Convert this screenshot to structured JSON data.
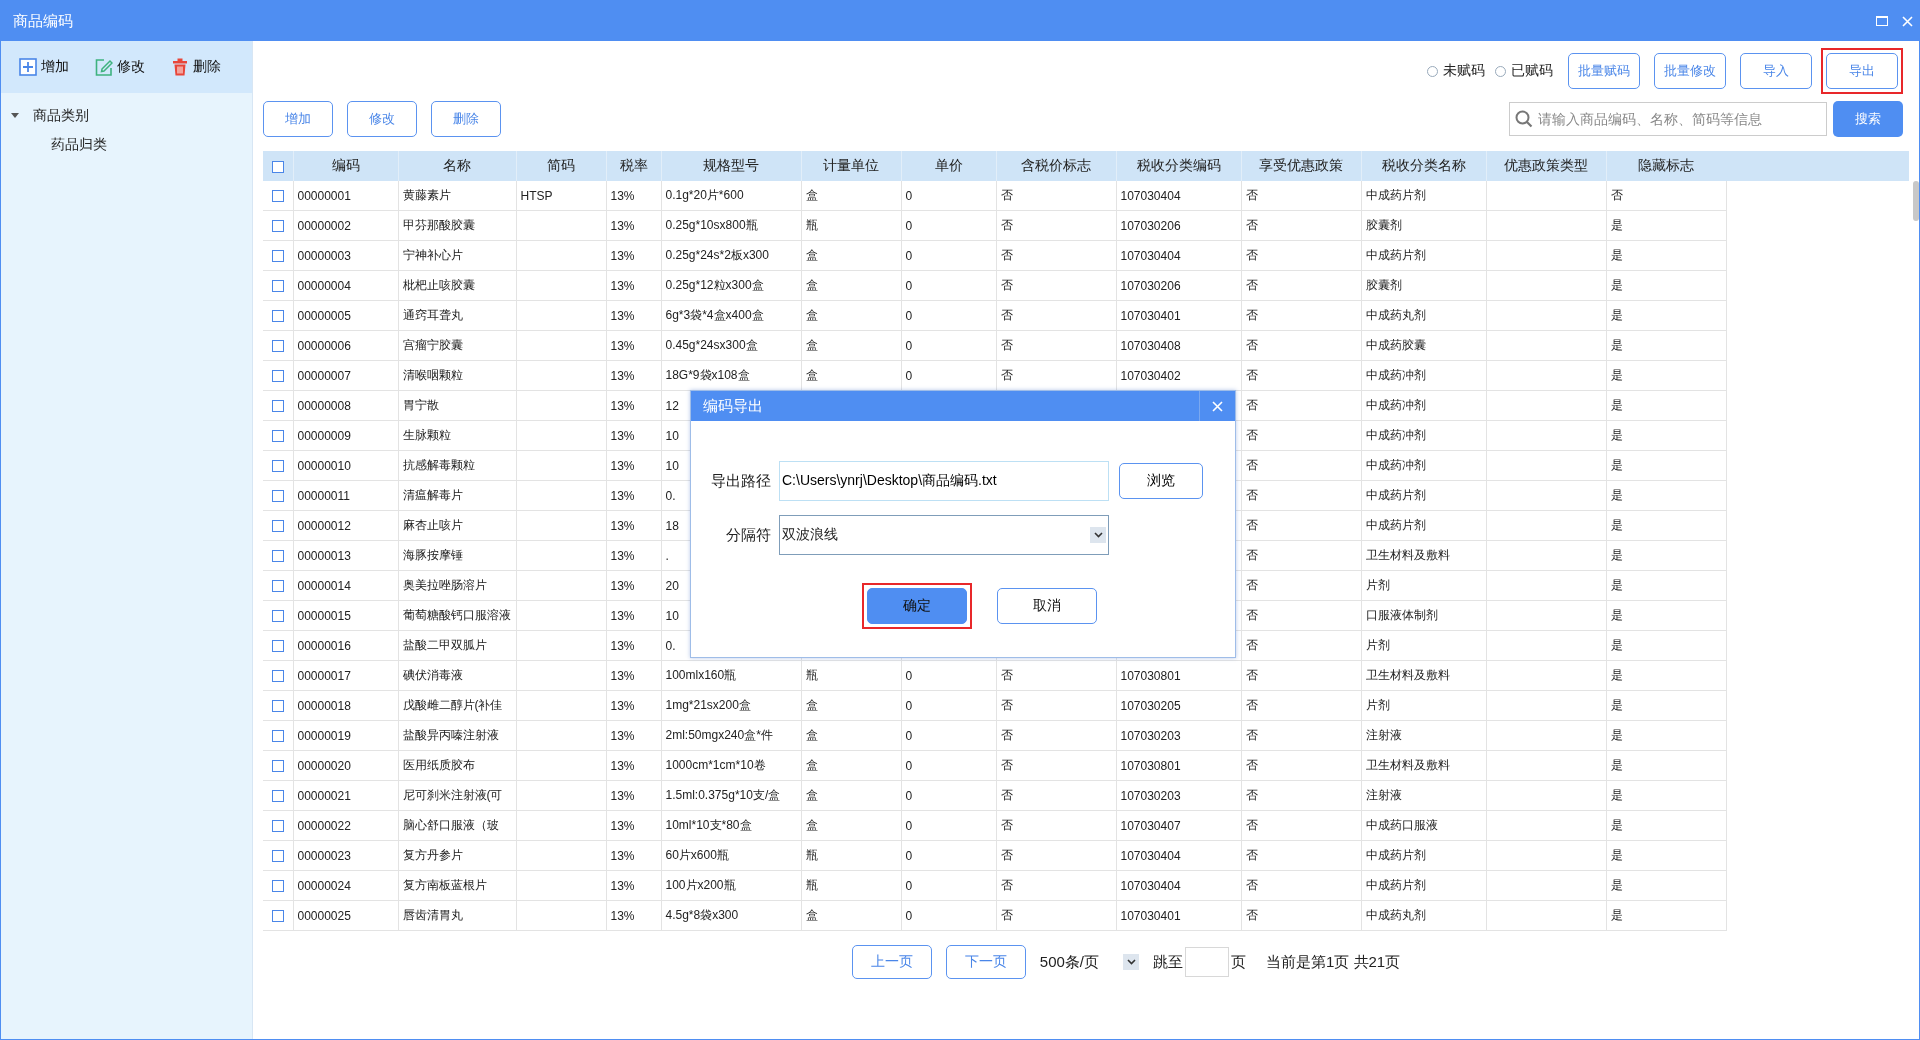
{
  "window": {
    "title": "商品编码"
  },
  "sidebar": {
    "toolbar": [
      {
        "kind": "add",
        "label": "增加"
      },
      {
        "kind": "edit",
        "label": "修改"
      },
      {
        "kind": "delete",
        "label": "删除"
      }
    ],
    "tree": [
      {
        "label": "商品类别",
        "expanded": true,
        "children": [
          {
            "label": "药品归类"
          }
        ]
      }
    ]
  },
  "filters": [
    {
      "label": "未赋码",
      "selected": false
    },
    {
      "label": "已赋码",
      "selected": false
    }
  ],
  "top_buttons": [
    {
      "label": "批量赋码",
      "highlighted": false
    },
    {
      "label": "批量修改",
      "highlighted": false
    },
    {
      "label": "导入",
      "highlighted": false
    },
    {
      "label": "导出",
      "highlighted": true
    }
  ],
  "row_buttons": [
    "增加",
    "修改",
    "删除"
  ],
  "search": {
    "placeholder": "请输入商品编码、名称、简码等信息",
    "button": "搜索"
  },
  "table": {
    "select_all": false,
    "columns": [
      "编码",
      "名称",
      "简码",
      "税率",
      "规格型号",
      "计量单位",
      "单价",
      "含税价标志",
      "税收分类编码",
      "享受优惠政策",
      "税收分类名称",
      "优惠政策类型",
      "隐藏标志"
    ],
    "rows": [
      {
        "checked": false,
        "cells": [
          "00000001",
          "黄藤素片",
          "HTSP",
          "13%",
          "0.1g*20片*600",
          "盒",
          "0",
          "否",
          "107030404",
          "否",
          "中成药片剂",
          null,
          "否"
        ]
      },
      {
        "checked": false,
        "cells": [
          "00000002",
          "甲芬那酸胶囊",
          null,
          "13%",
          "0.25g*10sx800瓶",
          "瓶",
          "0",
          "否",
          "107030206",
          "否",
          "胶囊剂",
          null,
          "是"
        ]
      },
      {
        "checked": false,
        "cells": [
          "00000003",
          "宁神补心片",
          null,
          "13%",
          "0.25g*24s*2板x300",
          "盒",
          "0",
          "否",
          "107030404",
          "否",
          "中成药片剂",
          null,
          "是"
        ]
      },
      {
        "checked": false,
        "cells": [
          "00000004",
          "枇杷止咳胶囊",
          null,
          "13%",
          "0.25g*12粒x300盒",
          "盒",
          "0",
          "否",
          "107030206",
          "否",
          "胶囊剂",
          null,
          "是"
        ]
      },
      {
        "checked": false,
        "cells": [
          "00000005",
          "通窍耳聋丸",
          null,
          "13%",
          "6g*3袋*4盒x400盒",
          "盒",
          "0",
          "否",
          "107030401",
          "否",
          "中成药丸剂",
          null,
          "是"
        ]
      },
      {
        "checked": false,
        "cells": [
          "00000006",
          "宫瘤宁胶囊",
          null,
          "13%",
          "0.45g*24sx300盒",
          "盒",
          "0",
          "否",
          "107030408",
          "否",
          "中成药胶囊",
          null,
          "是"
        ]
      },
      {
        "checked": false,
        "cells": [
          "00000007",
          "清喉咽颗粒",
          null,
          "13%",
          "18G*9袋x108盒",
          "盒",
          "0",
          "否",
          "107030402",
          "否",
          "中成药冲剂",
          null,
          "是"
        ]
      },
      {
        "checked": false,
        "cells": [
          "00000008",
          "胃宁散",
          null,
          "13%",
          "12",
          null,
          null,
          null,
          null,
          "否",
          "中成药冲剂",
          null,
          "是"
        ]
      },
      {
        "checked": false,
        "cells": [
          "00000009",
          "生脉颗粒",
          null,
          "13%",
          "10",
          null,
          null,
          null,
          null,
          "否",
          "中成药冲剂",
          null,
          "是"
        ]
      },
      {
        "checked": false,
        "cells": [
          "00000010",
          "抗感解毒颗粒",
          null,
          "13%",
          "10",
          null,
          null,
          null,
          null,
          "否",
          "中成药冲剂",
          null,
          "是"
        ]
      },
      {
        "checked": false,
        "cells": [
          "00000011",
          "清瘟解毒片",
          null,
          "13%",
          "0.",
          null,
          null,
          null,
          null,
          "否",
          "中成药片剂",
          null,
          "是"
        ]
      },
      {
        "checked": false,
        "cells": [
          "00000012",
          "麻杏止咳片",
          null,
          "13%",
          "18",
          null,
          null,
          null,
          null,
          "否",
          "中成药片剂",
          null,
          "是"
        ]
      },
      {
        "checked": false,
        "cells": [
          "00000013",
          "海豚按摩锤",
          null,
          "13%",
          ".",
          null,
          null,
          null,
          null,
          "否",
          "卫生材料及敷料",
          null,
          "是"
        ]
      },
      {
        "checked": false,
        "cells": [
          "00000014",
          "奥美拉唑肠溶片",
          null,
          "13%",
          "20",
          null,
          null,
          null,
          null,
          "否",
          "片剂",
          null,
          "是"
        ]
      },
      {
        "checked": false,
        "cells": [
          "00000015",
          "葡萄糖酸钙口服溶液",
          null,
          "13%",
          "10",
          null,
          null,
          null,
          null,
          "否",
          "口服液体制剂",
          null,
          "是"
        ]
      },
      {
        "checked": false,
        "cells": [
          "00000016",
          "盐酸二甲双胍片",
          null,
          "13%",
          "0.",
          null,
          null,
          null,
          null,
          "否",
          "片剂",
          null,
          "是"
        ]
      },
      {
        "checked": false,
        "cells": [
          "00000017",
          "碘伏消毒液",
          null,
          "13%",
          "100mlx160瓶",
          "瓶",
          "0",
          "否",
          "107030801",
          "否",
          "卫生材料及敷料",
          null,
          "是"
        ]
      },
      {
        "checked": false,
        "cells": [
          "00000018",
          "戊酸雌二醇片(补佳",
          null,
          "13%",
          "1mg*21sx200盒",
          "盒",
          "0",
          "否",
          "107030205",
          "否",
          "片剂",
          null,
          "是"
        ]
      },
      {
        "checked": false,
        "cells": [
          "00000019",
          "盐酸异丙嗪注射液",
          null,
          "13%",
          "2ml:50mgx240盒*件",
          "盒",
          "0",
          "否",
          "107030203",
          "否",
          "注射液",
          null,
          "是"
        ]
      },
      {
        "checked": false,
        "cells": [
          "00000020",
          "医用纸质胶布",
          null,
          "13%",
          "1000cm*1cm*10卷",
          "盒",
          "0",
          "否",
          "107030801",
          "否",
          "卫生材料及敷料",
          null,
          "是"
        ]
      },
      {
        "checked": false,
        "cells": [
          "00000021",
          "尼可刹米注射液(可",
          null,
          "13%",
          "1.5ml:0.375g*10支/盒",
          "盒",
          "0",
          "否",
          "107030203",
          "否",
          "注射液",
          null,
          "是"
        ]
      },
      {
        "checked": false,
        "cells": [
          "00000022",
          "脑心舒口服液（玻",
          null,
          "13%",
          "10ml*10支*80盒",
          "盒",
          "0",
          "否",
          "107030407",
          "否",
          "中成药口服液",
          null,
          "是"
        ]
      },
      {
        "checked": false,
        "cells": [
          "00000023",
          "复方丹参片",
          null,
          "13%",
          "60片x600瓶",
          "瓶",
          "0",
          "否",
          "107030404",
          "否",
          "中成药片剂",
          null,
          "是"
        ]
      },
      {
        "checked": false,
        "cells": [
          "00000024",
          "复方南板蓝根片",
          null,
          "13%",
          "100片x200瓶",
          "瓶",
          "0",
          "否",
          "107030404",
          "否",
          "中成药片剂",
          null,
          "是"
        ]
      },
      {
        "checked": false,
        "cells": [
          "00000025",
          "唇齿清胃丸",
          null,
          "13%",
          "4.5g*8袋x300",
          "盒",
          "0",
          "否",
          "107030401",
          "否",
          "中成药丸剂",
          null,
          "是"
        ]
      }
    ]
  },
  "pagination": {
    "prev": "上一页",
    "next": "下一页",
    "page_size": "500条/页",
    "jump_label": "跳至",
    "page_unit": "页",
    "status": "当前是第1页 共21页"
  },
  "dialog": {
    "title": "编码导出",
    "path_label": "导出路径",
    "path_value": "C:\\Users\\ynrj\\Desktop\\商品编码.txt",
    "browse": "浏览",
    "separator_label": "分隔符",
    "separator_value": "双波浪线",
    "buttons": [
      {
        "kind": "primary",
        "label": "确定",
        "highlighted": true
      },
      {
        "kind": "secondary",
        "label": "取消",
        "highlighted": false
      }
    ]
  }
}
